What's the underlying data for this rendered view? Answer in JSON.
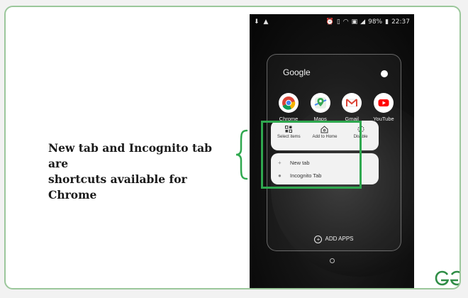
{
  "caption": {
    "line1": "New tab and Incognito tab are",
    "line2": "shortcuts available for Chrome"
  },
  "status_bar": {
    "battery": "98%",
    "time": "22:37",
    "icons": [
      "download-icon",
      "warning-icon",
      "alarm-icon",
      "vibrate-icon",
      "wifi-icon",
      "sim-icon",
      "signal-icon",
      "battery-icon"
    ]
  },
  "folder": {
    "title": "Google",
    "apps": [
      {
        "label": "Chrome",
        "icon": "chrome-icon"
      },
      {
        "label": "Maps",
        "icon": "maps-icon"
      },
      {
        "label": "Gmail",
        "icon": "gmail-icon"
      },
      {
        "label": "YouTube",
        "icon": "youtube-icon"
      }
    ],
    "add_apps_label": "ADD APPS"
  },
  "context_menu": {
    "options": [
      {
        "label": "Select items",
        "icon": "select-items-icon"
      },
      {
        "label": "Add to Home",
        "icon": "add-to-home-icon"
      },
      {
        "label": "Disable",
        "icon": "disable-icon"
      }
    ],
    "shortcuts": [
      {
        "label": "New tab",
        "icon": "plus-icon"
      },
      {
        "label": "Incognito Tab",
        "icon": "incognito-icon"
      }
    ]
  },
  "colors": {
    "highlight": "#2fa84f",
    "brace": "#2fa84f",
    "frame_border": "#9bc79b"
  }
}
